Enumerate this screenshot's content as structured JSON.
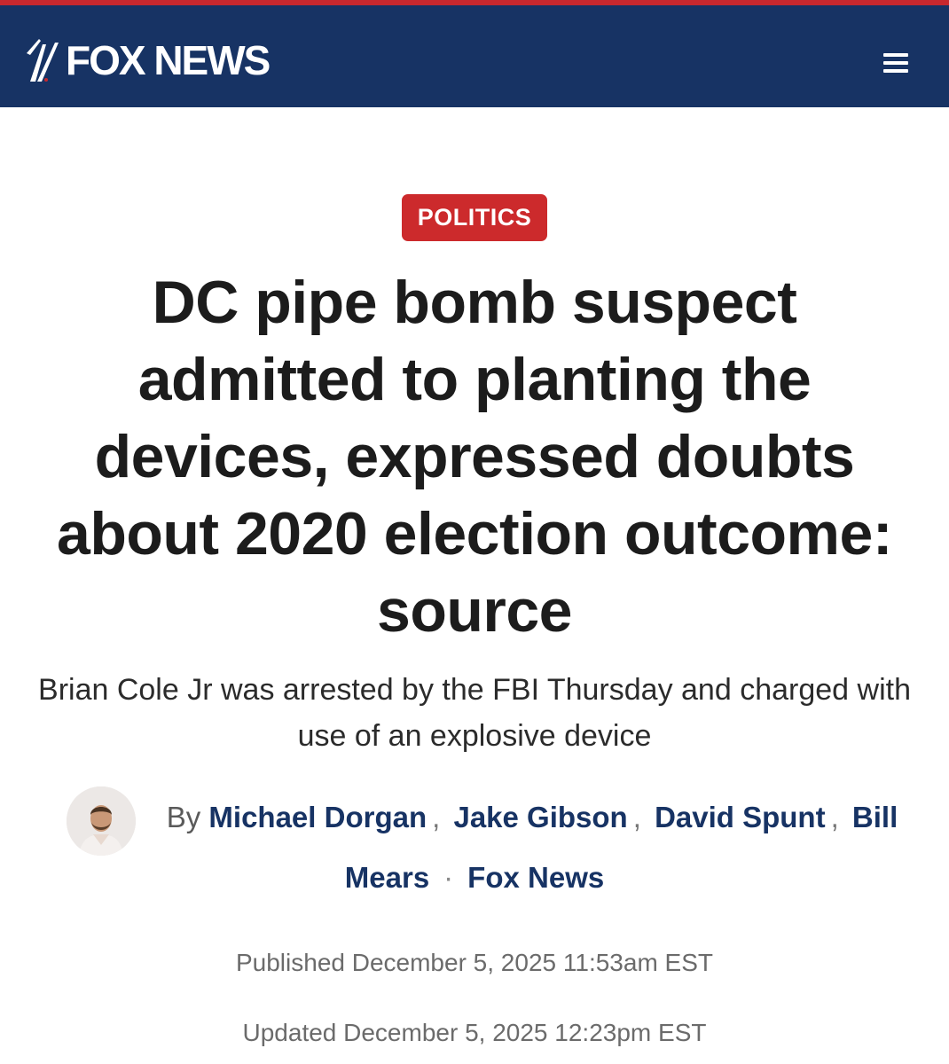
{
  "header": {
    "logo_text": "FOX NEWS",
    "menu_icon": "hamburger-menu-icon"
  },
  "colors": {
    "brand_navy": "#173364",
    "accent_red": "#cc2a2c",
    "top_strip": "#c8282e"
  },
  "article": {
    "category": "POLITICS",
    "headline": "DC pipe bomb suspect admitted to planting the devices, expressed doubts about 2020 election outcome: source",
    "subheadline": "Brian Cole Jr was arrested by the FBI Thursday and charged with use of an explosive device",
    "byline": {
      "prefix": "By",
      "authors": [
        "Michael Dorgan",
        "Jake Gibson",
        "David Spunt",
        "Bill",
        "Mears"
      ],
      "separator": ",",
      "dot": "·",
      "source": "Fox News"
    },
    "published": "Published December 5, 2025 11:53am EST",
    "updated": "Updated December 5, 2025 12:23pm EST"
  }
}
